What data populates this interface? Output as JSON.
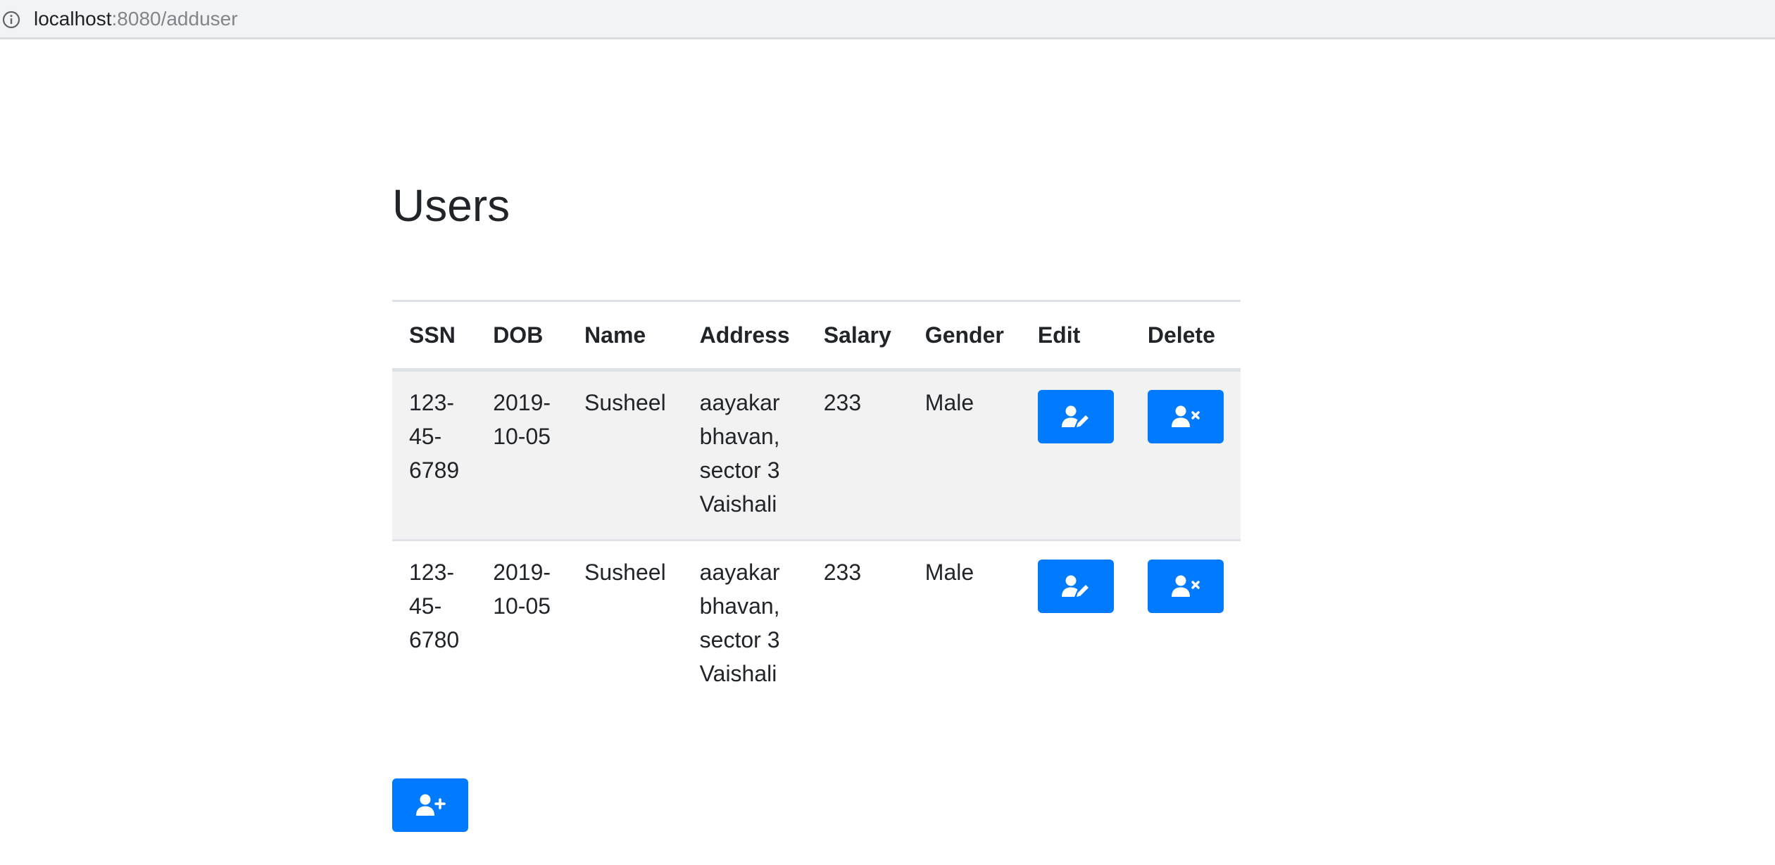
{
  "browser": {
    "url_host": "localhost",
    "url_rest": ":8080/adduser"
  },
  "page": {
    "title": "Users"
  },
  "table": {
    "headers": [
      "SSN",
      "DOB",
      "Name",
      "Address",
      "Salary",
      "Gender",
      "Edit",
      "Delete"
    ],
    "rows": [
      {
        "ssn": "123-45-6789",
        "dob": "2019-10-05",
        "name": "Susheel",
        "address": "aayakar bhavan, sector 3 Vaishali",
        "salary": "233",
        "gender": "Male"
      },
      {
        "ssn": "123-45-6780",
        "dob": "2019-10-05",
        "name": "Susheel",
        "address": "aayakar bhavan, sector 3 Vaishali",
        "salary": "233",
        "gender": "Male"
      }
    ]
  },
  "icons": {
    "edit": "user-edit-icon",
    "delete": "user-times-icon",
    "add": "user-plus-icon",
    "info": "info-icon"
  },
  "colors": {
    "primary": "#007bff",
    "stripe": "#f2f2f2",
    "border": "#dee2e6",
    "text": "#212529"
  }
}
